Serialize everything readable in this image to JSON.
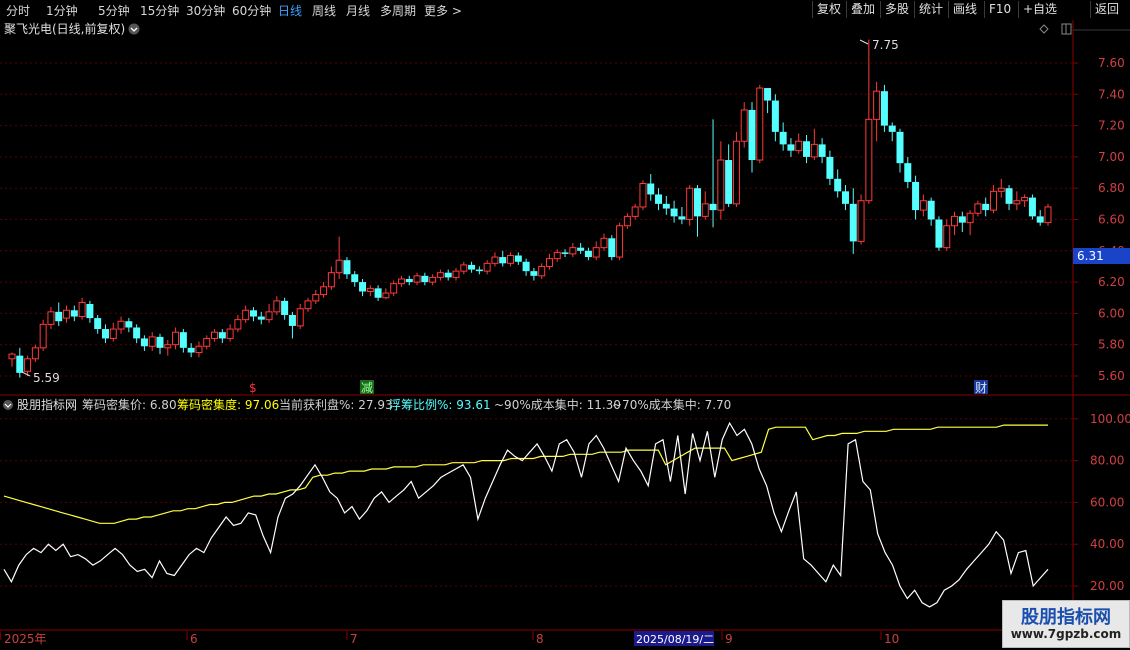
{
  "toolbar": {
    "timeframes": [
      "分时",
      "1分钟",
      "5分钟",
      "15分钟",
      "30分钟",
      "60分钟",
      "日线",
      "周线",
      "月线",
      "多周期",
      "更多 >"
    ],
    "active_timeframe": "日线",
    "tools": [
      "复权",
      "叠加",
      "多股",
      "统计",
      "画线",
      "F10",
      "+自选",
      "返回"
    ]
  },
  "main_chart": {
    "title": "聚飞光电(日线,前复权)",
    "y_ticks": [
      "7.60",
      "7.40",
      "7.20",
      "7.00",
      "6.80",
      "6.60",
      "6.40",
      "6.20",
      "6.00",
      "5.80",
      "5.60"
    ],
    "max_label": "7.75",
    "min_label": "5.59",
    "current_price": "6.31",
    "markers": [
      {
        "text": "$",
        "color": "#ff3030"
      },
      {
        "text": "减",
        "color": "#4ad04a"
      },
      {
        "text": "财",
        "color": "#7aa6ff"
      }
    ],
    "colors": {
      "up": "#ff3a3a",
      "down": "#54ffff",
      "grid": "#5a0000"
    }
  },
  "indicator": {
    "name": "股朋指标网",
    "items": [
      {
        "text": "筹码密集价: 6.80",
        "color": "#d0d0d0"
      },
      {
        "text": "筹码密集度: 97.06",
        "color": "#ffff00"
      },
      {
        "text": "当前获利盘%: 27.93",
        "color": "#d0d0d0"
      },
      {
        "text": "浮筹比例%: 93.61",
        "color": "#54ffff"
      },
      {
        "text": "~90%成本集中: 11.30",
        "color": "#d0d0d0"
      },
      {
        "text": "~70%成本集中: 7.70",
        "color": "#d0d0d0"
      }
    ],
    "y_ticks": [
      "100.00",
      "80.00",
      "60.00",
      "40.00",
      "20.00"
    ]
  },
  "x_axis": {
    "labels": [
      "2025年",
      "6",
      "7",
      "8",
      "9",
      "10"
    ],
    "cursor_date": "2025/08/19/二"
  },
  "watermark": {
    "title": "股朋指标网",
    "url": "www.7gpzb.com"
  },
  "candles": [
    [
      5.71,
      5.74,
      5.66,
      5.75
    ],
    [
      5.73,
      5.62,
      5.59,
      5.78
    ],
    [
      5.63,
      5.71,
      5.6,
      5.73
    ],
    [
      5.71,
      5.78,
      5.69,
      5.8
    ],
    [
      5.78,
      5.93,
      5.76,
      5.96
    ],
    [
      5.93,
      6.01,
      5.9,
      6.04
    ],
    [
      6.01,
      5.95,
      5.92,
      6.07
    ],
    [
      5.97,
      6.02,
      5.94,
      6.05
    ],
    [
      6.02,
      5.98,
      5.95,
      6.05
    ],
    [
      5.98,
      6.07,
      5.96,
      6.1
    ],
    [
      6.06,
      5.97,
      5.94,
      6.08
    ],
    [
      5.97,
      5.9,
      5.87,
      5.99
    ],
    [
      5.9,
      5.84,
      5.81,
      5.93
    ],
    [
      5.84,
      5.9,
      5.82,
      5.94
    ],
    [
      5.9,
      5.95,
      5.87,
      5.98
    ],
    [
      5.95,
      5.91,
      5.88,
      5.97
    ],
    [
      5.91,
      5.84,
      5.81,
      5.93
    ],
    [
      5.84,
      5.79,
      5.76,
      5.86
    ],
    [
      5.79,
      5.85,
      5.76,
      5.88
    ],
    [
      5.85,
      5.78,
      5.74,
      5.87
    ],
    [
      5.78,
      5.8,
      5.73,
      5.83
    ],
    [
      5.8,
      5.88,
      5.77,
      5.91
    ],
    [
      5.88,
      5.78,
      5.75,
      5.9
    ],
    [
      5.78,
      5.75,
      5.72,
      5.81
    ],
    [
      5.75,
      5.79,
      5.72,
      5.82
    ],
    [
      5.79,
      5.84,
      5.77,
      5.86
    ],
    [
      5.84,
      5.88,
      5.82,
      5.9
    ],
    [
      5.88,
      5.84,
      5.81,
      5.9
    ],
    [
      5.84,
      5.9,
      5.82,
      5.93
    ],
    [
      5.9,
      5.96,
      5.88,
      5.99
    ],
    [
      5.96,
      6.02,
      5.94,
      6.05
    ],
    [
      6.02,
      5.98,
      5.95,
      6.04
    ],
    [
      5.98,
      5.96,
      5.93,
      6.01
    ],
    [
      5.96,
      6.01,
      5.94,
      6.06
    ],
    [
      6.01,
      6.08,
      5.99,
      6.11
    ],
    [
      6.08,
      5.99,
      5.96,
      6.1
    ],
    [
      5.99,
      5.92,
      5.84,
      6.01
    ],
    [
      5.92,
      6.03,
      5.9,
      6.06
    ],
    [
      6.03,
      6.08,
      6.01,
      6.1
    ],
    [
      6.08,
      6.12,
      6.06,
      6.15
    ],
    [
      6.12,
      6.17,
      6.1,
      6.2
    ],
    [
      6.17,
      6.26,
      6.15,
      6.3
    ],
    [
      6.26,
      6.34,
      6.22,
      6.49
    ],
    [
      6.34,
      6.25,
      6.22,
      6.36
    ],
    [
      6.25,
      6.2,
      6.17,
      6.27
    ],
    [
      6.2,
      6.14,
      6.11,
      6.22
    ],
    [
      6.14,
      6.16,
      6.11,
      6.18
    ],
    [
      6.16,
      6.1,
      6.08,
      6.18
    ],
    [
      6.1,
      6.13,
      6.09,
      6.16
    ],
    [
      6.13,
      6.19,
      6.11,
      6.21
    ],
    [
      6.19,
      6.22,
      6.17,
      6.24
    ],
    [
      6.22,
      6.2,
      6.18,
      6.24
    ],
    [
      6.2,
      6.24,
      6.18,
      6.26
    ],
    [
      6.24,
      6.2,
      6.18,
      6.26
    ],
    [
      6.2,
      6.23,
      6.18,
      6.25
    ],
    [
      6.23,
      6.26,
      6.21,
      6.28
    ],
    [
      6.26,
      6.23,
      6.21,
      6.28
    ],
    [
      6.23,
      6.27,
      6.21,
      6.29
    ],
    [
      6.27,
      6.31,
      6.25,
      6.33
    ],
    [
      6.31,
      6.28,
      6.26,
      6.33
    ],
    [
      6.28,
      6.27,
      6.25,
      6.3
    ],
    [
      6.27,
      6.32,
      6.25,
      6.34
    ],
    [
      6.32,
      6.36,
      6.3,
      6.39
    ],
    [
      6.36,
      6.32,
      6.3,
      6.4
    ],
    [
      6.32,
      6.37,
      6.3,
      6.39
    ],
    [
      6.37,
      6.33,
      6.31,
      6.39
    ],
    [
      6.33,
      6.27,
      6.24,
      6.35
    ],
    [
      6.27,
      6.24,
      6.21,
      6.29
    ],
    [
      6.24,
      6.3,
      6.22,
      6.32
    ],
    [
      6.3,
      6.35,
      6.28,
      6.38
    ],
    [
      6.35,
      6.39,
      6.33,
      6.41
    ],
    [
      6.39,
      6.38,
      6.36,
      6.41
    ],
    [
      6.38,
      6.42,
      6.36,
      6.45
    ],
    [
      6.42,
      6.4,
      6.38,
      6.45
    ],
    [
      6.4,
      6.36,
      6.34,
      6.42
    ],
    [
      6.36,
      6.42,
      6.34,
      6.46
    ],
    [
      6.42,
      6.48,
      6.4,
      6.51
    ],
    [
      6.48,
      6.36,
      6.34,
      6.5
    ],
    [
      6.36,
      6.56,
      6.34,
      6.58
    ],
    [
      6.56,
      6.62,
      6.54,
      6.64
    ],
    [
      6.62,
      6.68,
      6.6,
      6.7
    ],
    [
      6.68,
      6.83,
      6.66,
      6.85
    ],
    [
      6.83,
      6.76,
      6.72,
      6.89
    ],
    [
      6.76,
      6.7,
      6.66,
      6.8
    ],
    [
      6.7,
      6.67,
      6.63,
      6.75
    ],
    [
      6.67,
      6.62,
      6.58,
      6.72
    ],
    [
      6.62,
      6.6,
      6.57,
      6.68
    ],
    [
      6.6,
      6.8,
      6.56,
      6.82
    ],
    [
      6.8,
      6.62,
      6.49,
      6.82
    ],
    [
      6.62,
      6.7,
      6.6,
      6.78
    ],
    [
      6.7,
      6.66,
      6.55,
      7.24
    ],
    [
      6.66,
      6.98,
      6.6,
      7.1
    ],
    [
      6.98,
      6.7,
      6.68,
      7.08
    ],
    [
      6.7,
      7.1,
      6.68,
      7.16
    ],
    [
      7.1,
      7.3,
      7.06,
      7.35
    ],
    [
      7.3,
      6.98,
      6.9,
      7.35
    ],
    [
      6.98,
      7.44,
      6.96,
      7.46
    ],
    [
      7.44,
      7.36,
      7.28,
      7.42
    ],
    [
      7.36,
      7.16,
      7.1,
      7.4
    ],
    [
      7.16,
      7.08,
      7.04,
      7.22
    ],
    [
      7.08,
      7.04,
      7.0,
      7.12
    ],
    [
      7.04,
      7.1,
      7.02,
      7.15
    ],
    [
      7.1,
      7.0,
      6.96,
      7.14
    ],
    [
      7.0,
      7.08,
      6.98,
      7.18
    ],
    [
      7.08,
      7.0,
      6.96,
      7.12
    ],
    [
      7.0,
      6.86,
      6.82,
      7.04
    ],
    [
      6.86,
      6.78,
      6.74,
      6.92
    ],
    [
      6.78,
      6.7,
      6.66,
      6.82
    ],
    [
      6.7,
      6.46,
      6.38,
      6.8
    ],
    [
      6.46,
      6.72,
      6.44,
      6.76
    ],
    [
      6.72,
      7.24,
      6.7,
      7.75
    ],
    [
      7.24,
      7.42,
      7.1,
      7.48
    ],
    [
      7.42,
      7.2,
      7.16,
      7.46
    ],
    [
      7.2,
      7.16,
      7.1,
      7.22
    ],
    [
      7.16,
      6.96,
      6.9,
      7.18
    ],
    [
      6.96,
      6.84,
      6.8,
      7.0
    ],
    [
      6.84,
      6.66,
      6.6,
      6.88
    ],
    [
      6.66,
      6.72,
      6.62,
      6.76
    ],
    [
      6.72,
      6.6,
      6.56,
      6.74
    ],
    [
      6.6,
      6.42,
      6.4,
      6.62
    ],
    [
      6.42,
      6.56,
      6.4,
      6.6
    ],
    [
      6.56,
      6.62,
      6.5,
      6.65
    ],
    [
      6.62,
      6.58,
      6.52,
      6.65
    ],
    [
      6.58,
      6.64,
      6.5,
      6.66
    ],
    [
      6.64,
      6.7,
      6.62,
      6.72
    ],
    [
      6.7,
      6.66,
      6.62,
      6.74
    ],
    [
      6.66,
      6.78,
      6.64,
      6.82
    ],
    [
      6.78,
      6.8,
      6.74,
      6.86
    ],
    [
      6.8,
      6.7,
      6.66,
      6.82
    ],
    [
      6.7,
      6.72,
      6.66,
      6.78
    ],
    [
      6.72,
      6.74,
      6.68,
      6.76
    ],
    [
      6.74,
      6.62,
      6.6,
      6.76
    ],
    [
      6.62,
      6.58,
      6.56,
      6.66
    ],
    [
      6.58,
      6.68,
      6.56,
      6.7
    ]
  ],
  "series": {
    "concentration": [
      63,
      62,
      61,
      60,
      59,
      58,
      57,
      56,
      55,
      54,
      53,
      52,
      51,
      50,
      50,
      50,
      51,
      52,
      52,
      53,
      53,
      54,
      55,
      56,
      56,
      57,
      57,
      58,
      59,
      59,
      60,
      60,
      61,
      62,
      63,
      63,
      64,
      64,
      65,
      66,
      66,
      67,
      72,
      73,
      73,
      74,
      74,
      75,
      75,
      75,
      76,
      76,
      76,
      77,
      77,
      77,
      77,
      78,
      78,
      78,
      78,
      79,
      79,
      79,
      79,
      80,
      80,
      80,
      80,
      81,
      81,
      81,
      81,
      82,
      82,
      82,
      82,
      83,
      83,
      83,
      83,
      84,
      84,
      84,
      84,
      85,
      85,
      85,
      85,
      85,
      78,
      80,
      82,
      84,
      86,
      86,
      86,
      86,
      86,
      80,
      81,
      82,
      83,
      84,
      95,
      96,
      96,
      96,
      96,
      96,
      90,
      91,
      92,
      92,
      93,
      93,
      93,
      94,
      94,
      94,
      94,
      95,
      95,
      95,
      95,
      95,
      95,
      96,
      96,
      96,
      96,
      96,
      96,
      96,
      96,
      96,
      97,
      97,
      97,
      97,
      97,
      97,
      97
    ],
    "profit": [
      28,
      22,
      30,
      35,
      38,
      36,
      40,
      37,
      40,
      34,
      35,
      33,
      30,
      32,
      35,
      38,
      35,
      30,
      27,
      28,
      24,
      32,
      26,
      25,
      30,
      35,
      38,
      36,
      43,
      48,
      53,
      49,
      50,
      55,
      54,
      44,
      36,
      53,
      62,
      64,
      68,
      73,
      78,
      72,
      65,
      62,
      55,
      58,
      52,
      56,
      62,
      65,
      60,
      63,
      66,
      70,
      62,
      65,
      68,
      72,
      74,
      76,
      78,
      72,
      52,
      62,
      70,
      78,
      85,
      82,
      80,
      84,
      88,
      82,
      75,
      88,
      90,
      84,
      72,
      88,
      92,
      86,
      78,
      70,
      86,
      80,
      75,
      68,
      88,
      90,
      70,
      92,
      64,
      93,
      80,
      94,
      72,
      90,
      98,
      92,
      95,
      88,
      76,
      68,
      55,
      46,
      56,
      65,
      33,
      30,
      26,
      22,
      30,
      25,
      88,
      90,
      70,
      66,
      45,
      36,
      30,
      20,
      14,
      18,
      12,
      10,
      12,
      18,
      20,
      23,
      28,
      32,
      36,
      40,
      46,
      42,
      26,
      36,
      37,
      20,
      24,
      28
    ]
  }
}
